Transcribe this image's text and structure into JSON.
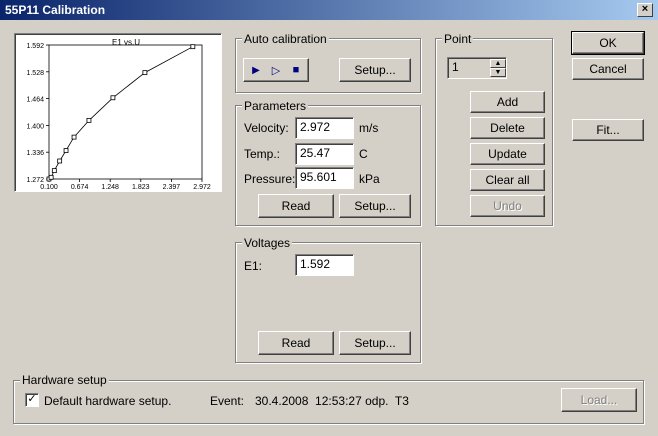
{
  "window": {
    "title": "55P11 Calibration",
    "close_label": "×"
  },
  "chart_data": {
    "type": "line",
    "title": "E1 vs.U",
    "y_ticks": [
      "1.592",
      "1.528",
      "1.464",
      "1.400",
      "1.336",
      "1.272"
    ],
    "x_ticks": [
      "0.100",
      "0.674",
      "1.248",
      "1.823",
      "2.397",
      "2.972"
    ],
    "xlim": [
      0.1,
      2.972
    ],
    "ylim": [
      1.272,
      1.592
    ],
    "series": [
      {
        "x": [
          0.1,
          0.14,
          0.2,
          0.3,
          0.42,
          0.57,
          0.85,
          1.3,
          1.9,
          2.8
        ],
        "y": [
          1.272,
          1.276,
          1.292,
          1.315,
          1.34,
          1.372,
          1.412,
          1.466,
          1.526,
          1.588
        ]
      }
    ]
  },
  "auto_calibration": {
    "title": "Auto calibration",
    "play_icon": "▶",
    "step_icon": "▷",
    "stop_icon": "■",
    "setup_label": "Setup..."
  },
  "parameters": {
    "title": "Parameters",
    "velocity_label": "Velocity:",
    "velocity_value": "2.972",
    "velocity_unit": "m/s",
    "temp_label": "Temp.:",
    "temp_value": "25.47",
    "temp_unit": "C",
    "pressure_label": "Pressure:",
    "pressure_value": "95.601",
    "pressure_unit": "kPa",
    "read_label": "Read",
    "setup_label": "Setup..."
  },
  "voltages": {
    "title": "Voltages",
    "e1_label": "E1:",
    "e1_value": "1.592",
    "read_label": "Read",
    "setup_label": "Setup..."
  },
  "point": {
    "title": "Point",
    "value": "1",
    "add_label": "Add",
    "delete_label": "Delete",
    "update_label": "Update",
    "clear_label": "Clear all",
    "undo_label": "Undo"
  },
  "dialog_buttons": {
    "ok_label": "OK",
    "cancel_label": "Cancel",
    "fit_label": "Fit..."
  },
  "hardware_setup": {
    "title": "Hardware setup",
    "default_label": "Default hardware setup.",
    "checked_mark": "✓",
    "event_label": "Event:",
    "event_value": "30.4.2008  12:53:27 odp.  T3",
    "load_label": "Load..."
  }
}
